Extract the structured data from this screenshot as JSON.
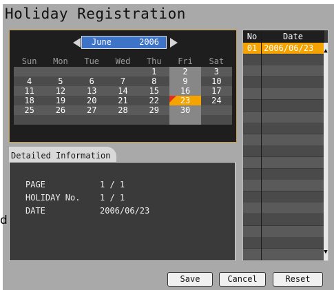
{
  "window": {
    "title": "Holiday Registration"
  },
  "outside_label": "d",
  "calendar": {
    "month": "June",
    "year": "2006",
    "weekdays": [
      "Sun",
      "Mon",
      "Tue",
      "Wed",
      "Thu",
      "Fri",
      "Sat"
    ],
    "weeks": [
      [
        "",
        "",
        "",
        "",
        "1",
        "2",
        "3"
      ],
      [
        "4",
        "5",
        "6",
        "7",
        "8",
        "9",
        "10"
      ],
      [
        "11",
        "12",
        "13",
        "14",
        "15",
        "16",
        "17"
      ],
      [
        "18",
        "19",
        "20",
        "21",
        "22",
        "23",
        "24"
      ],
      [
        "25",
        "26",
        "27",
        "28",
        "29",
        "30",
        ""
      ],
      [
        "",
        "",
        "",
        "",
        "",
        "",
        ""
      ]
    ],
    "selected_day": "23",
    "colors": {
      "selected": "#f5a300",
      "header": "#3d74c8",
      "holiday_marker": "#e03020"
    }
  },
  "detail": {
    "tab_label": "Detailed Information",
    "rows": [
      {
        "label": "PAGE",
        "value": "1 / 1"
      },
      {
        "label": "HOLIDAY No.",
        "value": "1 / 1"
      },
      {
        "label": "DATE",
        "value": "2006/06/23"
      }
    ]
  },
  "list": {
    "headers": {
      "no": "No",
      "date": "Date"
    },
    "rows": [
      {
        "no": "01",
        "date": "2006/06/23"
      }
    ],
    "total_rows": 19
  },
  "buttons": {
    "save": "Save",
    "cancel": "Cancel",
    "reset": "Reset"
  }
}
